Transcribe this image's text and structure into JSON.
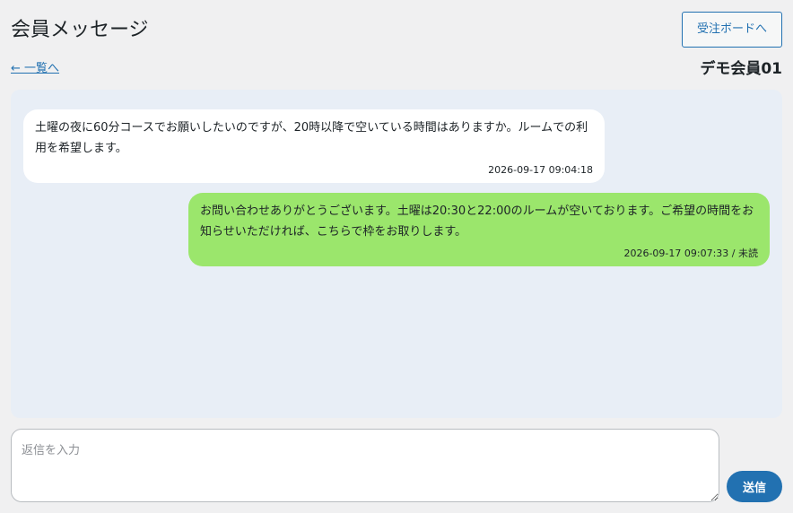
{
  "header": {
    "title": "会員メッセージ",
    "order_board_label": "受注ボードへ",
    "back_link_label": "← 一覧へ",
    "member_name": "デモ会員01"
  },
  "thread": {
    "messages": [
      {
        "direction": "incoming",
        "text": "土曜の夜に60分コースでお願いしたいのですが、20時以降で空いている時間はありますか。ルームでの利用を希望します。",
        "meta": "2026-09-17 09:04:18"
      },
      {
        "direction": "outgoing",
        "text": "お問い合わせありがとうございます。土曜は20:30と22:00のルームが空いております。ご希望の時間をお知らせいただければ、こちらで枠をお取りします。",
        "meta": "2026-09-17 09:07:33 / 未読"
      }
    ]
  },
  "composer": {
    "placeholder": "返信を入力",
    "value": "",
    "send_label": "送信"
  },
  "colors": {
    "accent": "#2271b1",
    "thread_background": "#e8eef6",
    "incoming_bubble": "#ffffff",
    "outgoing_bubble": "#9be66c",
    "page_background": "#f0f0f1"
  }
}
